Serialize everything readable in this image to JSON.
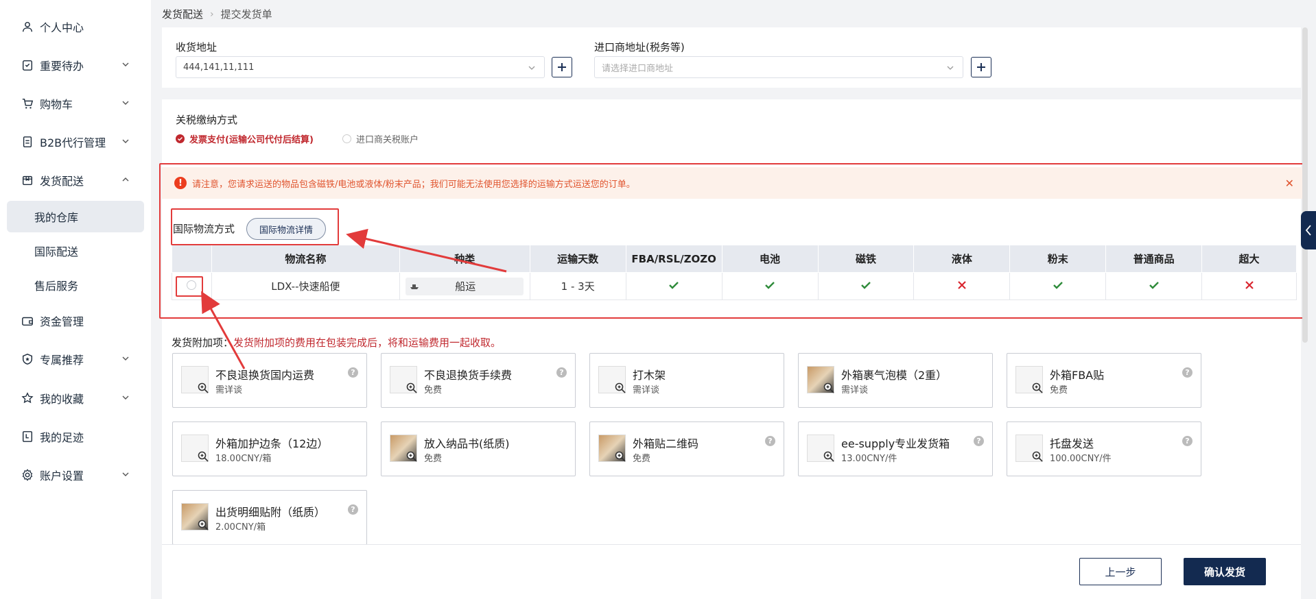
{
  "sidebar": {
    "items": [
      {
        "label": "个人中心",
        "icon": "user-icon"
      },
      {
        "label": "重要待办",
        "icon": "todo-icon"
      },
      {
        "label": "购物车",
        "icon": "cart-icon"
      },
      {
        "label": "B2B代行管理",
        "icon": "document-icon"
      },
      {
        "label": "发货配送",
        "icon": "box-icon"
      },
      {
        "label": "资金管理",
        "icon": "wallet-icon"
      },
      {
        "label": "专属推荐",
        "icon": "shield-icon"
      },
      {
        "label": "我的收藏",
        "icon": "star-icon"
      },
      {
        "label": "我的足迹",
        "icon": "history-icon"
      },
      {
        "label": "账户设置",
        "icon": "gear-icon"
      }
    ],
    "sub_items": [
      {
        "label": "我的仓库"
      },
      {
        "label": "国际配送"
      },
      {
        "label": "售后服务"
      }
    ]
  },
  "breadcrumb": {
    "root": "发货配送",
    "current": "提交发货单"
  },
  "address": {
    "receive_label": "收货地址",
    "receive_value": "444,141,11,111",
    "importer_label": "进口商地址(税务等)",
    "importer_placeholder": "请选择进口商地址"
  },
  "tax": {
    "label": "关税缴纳方式",
    "option_selected": "发票支付(运输公司代付后结算)",
    "option_other": "进口商关税账户"
  },
  "alert": {
    "text": "请注意，您请求运送的物品包含磁铁/电池或液体/粉末产品；我们可能无法使用您选择的运输方式运送您的订单。"
  },
  "shipping": {
    "label": "国际物流方式",
    "detail_button": "国际物流详情",
    "columns": [
      "",
      "物流名称",
      "种类",
      "运输天数",
      "FBA/RSL/ZOZO",
      "电池",
      "磁铁",
      "液体",
      "粉末",
      "普通商品",
      "超大"
    ],
    "rows": [
      {
        "name": "LDX--快速船便",
        "kind": "船运",
        "days": "1 - 3天",
        "flags": [
          "yes",
          "yes",
          "yes",
          "no",
          "yes",
          "yes",
          "no"
        ]
      }
    ],
    "colors": {
      "yes": "#2e8b3a",
      "no": "#d9262f"
    }
  },
  "addons": {
    "title": "发货附加项",
    "note": "发货附加项的费用在包装完成后，将和运输费用一起收取。",
    "items": [
      {
        "name": "不良退换货国内运费",
        "price": "需详谈",
        "help": "?"
      },
      {
        "name": "不良退换货手续费",
        "price": "免费",
        "help": "?"
      },
      {
        "name": "打木架",
        "price": "需详谈",
        "help": ""
      },
      {
        "name": "外箱裹气泡模（2重）",
        "price": "需详谈",
        "help": ""
      },
      {
        "name": "外箱FBA贴",
        "price": "免费",
        "help": "?"
      },
      {
        "name": "外箱加护边条（12边）",
        "price": "18.00CNY/箱",
        "help": ""
      },
      {
        "name": "放入纳品书(纸质)",
        "price": "免费",
        "help": ""
      },
      {
        "name": "外箱贴二维码",
        "price": "免费",
        "help": "?"
      },
      {
        "name": "ee-supply专业发货箱",
        "price": "13.00CNY/件",
        "help": "?"
      },
      {
        "name": "托盘发送",
        "price": "100.00CNY/件",
        "help": "?"
      },
      {
        "name": "出货明细贴附（纸质）",
        "price": "2.00CNY/箱",
        "help": "?"
      }
    ]
  },
  "footer": {
    "prev_label": "上一步",
    "confirm_label": "确认发货"
  },
  "theme": {
    "primary": "#132a50",
    "accent_red": "#c0282e",
    "annotation_red": "#e23b3b"
  }
}
